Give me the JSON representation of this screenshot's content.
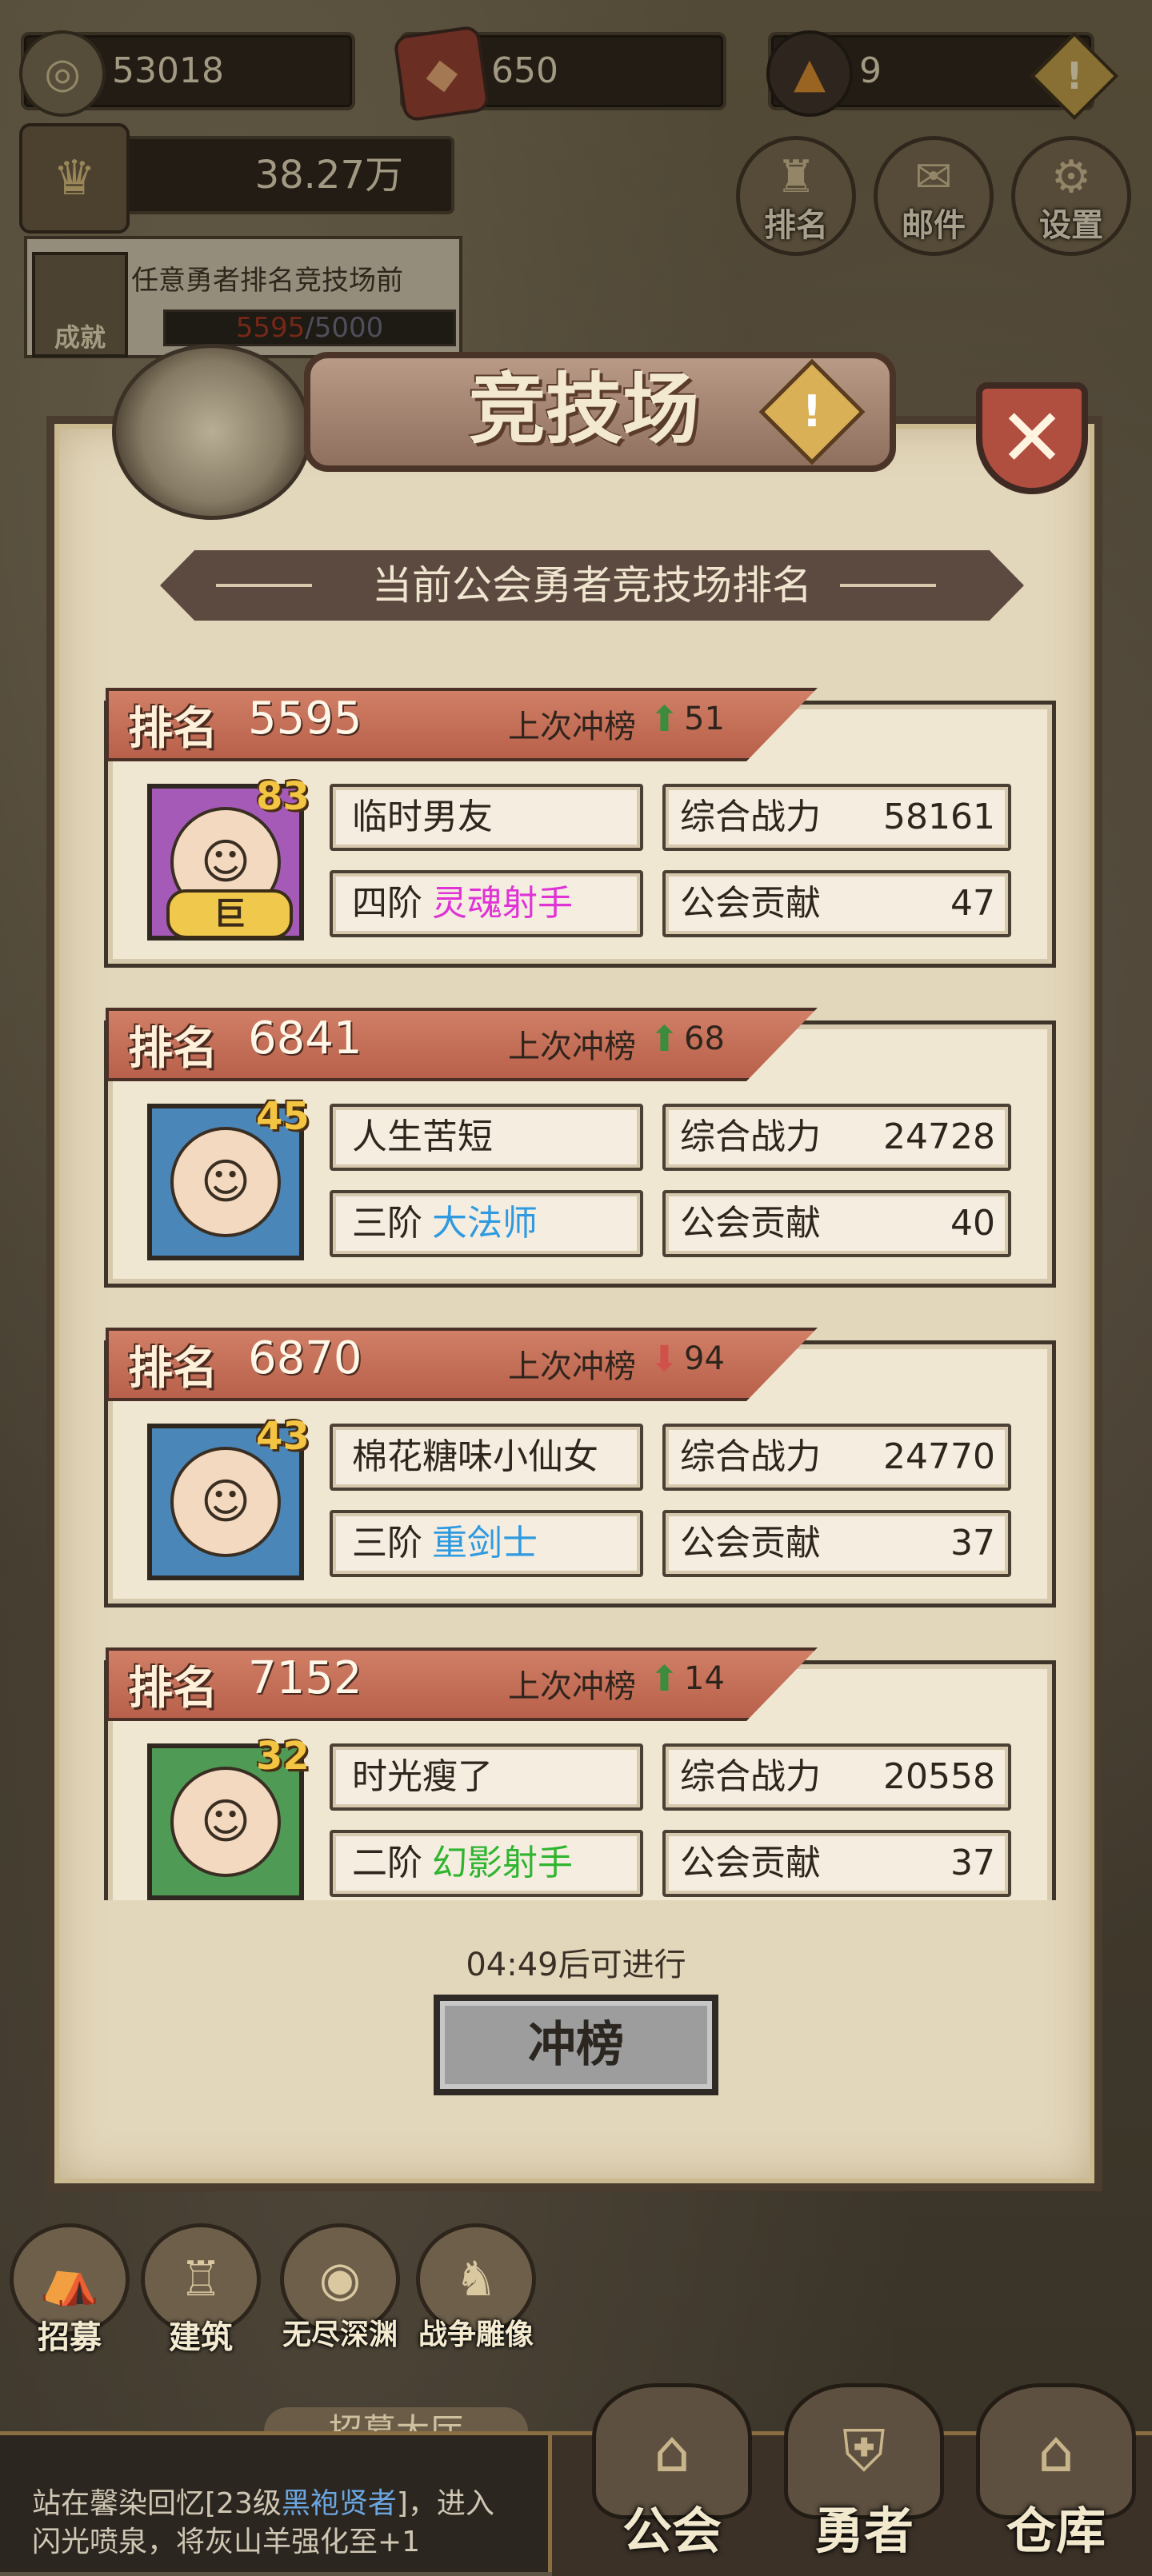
{
  "resources": {
    "gold": "53018",
    "gems": "650",
    "tickets": "9",
    "alert": "!"
  },
  "power": "38.27万",
  "top_buttons": [
    {
      "label": "排名",
      "icon": "trophy-icon"
    },
    {
      "label": "邮件",
      "icon": "mail-icon"
    },
    {
      "label": "设置",
      "icon": "gear-icon"
    }
  ],
  "achievement": {
    "label": "成就",
    "text": "任意勇者排名竞技场前",
    "current": "5595",
    "total": "5000"
  },
  "modal": {
    "title": "竞技场",
    "title_alert": "!",
    "close": "✕",
    "subtitle": "当前公会勇者竞技场排名"
  },
  "labels": {
    "rank": "排名",
    "last_rush": "上次冲榜",
    "combat_power": "综合战力",
    "guild_contribution": "公会贡献"
  },
  "entries": [
    {
      "rank": "5595",
      "change": "51",
      "direction": "up",
      "level": "83",
      "tag": "巨",
      "name": "临时男友",
      "tier": "四阶",
      "class_name": "灵魂射手",
      "class_color": "#e033d6",
      "power": "58161",
      "contribution": "47",
      "frame_color": "#a45ab6"
    },
    {
      "rank": "6841",
      "change": "68",
      "direction": "up",
      "level": "45",
      "tag": "",
      "name": "人生苦短",
      "tier": "三阶",
      "class_name": "大法师",
      "class_color": "#2f9ae0",
      "power": "24728",
      "contribution": "40",
      "frame_color": "#4b86b8"
    },
    {
      "rank": "6870",
      "change": "94",
      "direction": "down",
      "level": "43",
      "tag": "",
      "name": "棉花糖味小仙女",
      "tier": "三阶",
      "class_name": "重剑士",
      "class_color": "#2f9ae0",
      "power": "24770",
      "contribution": "37",
      "frame_color": "#4b86b8"
    },
    {
      "rank": "7152",
      "change": "14",
      "direction": "up",
      "level": "32",
      "tag": "",
      "name": "时光瘦了",
      "tier": "二阶",
      "class_name": "幻影射手",
      "class_color": "#2fb52f",
      "power": "20558",
      "contribution": "37",
      "frame_color": "#4f9a54"
    }
  ],
  "cooldown_text": "04:49后可进行",
  "rush_button": "冲榜",
  "dock": [
    {
      "label": "招募",
      "icon": "tent-icon"
    },
    {
      "label": "建筑",
      "icon": "castle-icon"
    },
    {
      "label": "无尽深渊",
      "icon": "vortex-icon"
    },
    {
      "label": "战争雕像",
      "icon": "statue-icon"
    }
  ],
  "recruit_tab": "招募大厅",
  "log": {
    "prefix": "站在馨染回忆[23级",
    "highlight": "黑袍贤者",
    "suffix": "]，进入",
    "line2": "闪光喷泉，将灰山羊强化至+1"
  },
  "nav": [
    {
      "label": "公会",
      "icon": "guild-icon"
    },
    {
      "label": "勇者",
      "icon": "helmet-icon"
    },
    {
      "label": "仓库",
      "icon": "warehouse-icon"
    }
  ]
}
